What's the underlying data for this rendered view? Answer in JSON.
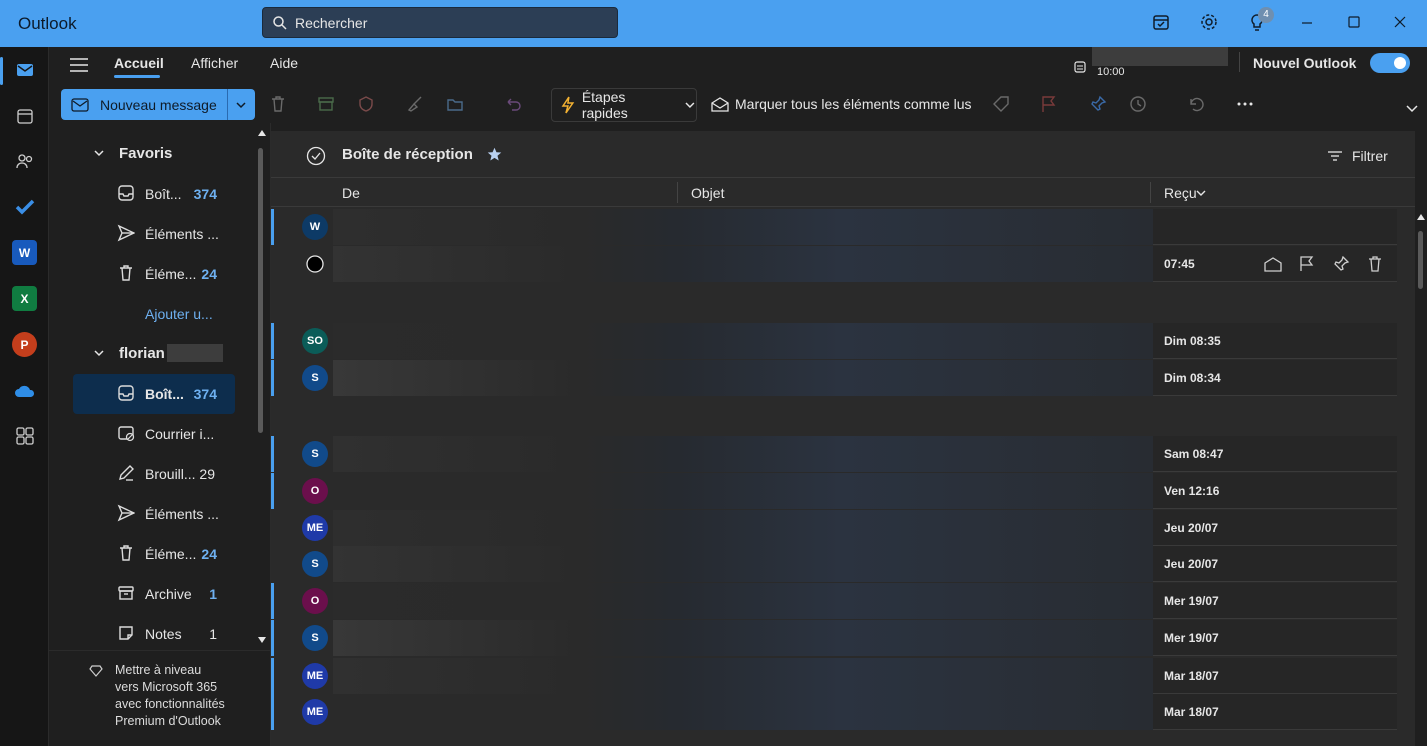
{
  "window": {
    "title": "Outlook"
  },
  "search": {
    "placeholder": "Rechercher"
  },
  "titlebar": {
    "badge_count": "4"
  },
  "menu": {
    "tabs": [
      "Accueil",
      "Afficher",
      "Aide"
    ],
    "clock": "10:00",
    "nouvel_outlook": "Nouvel Outlook"
  },
  "ribbon": {
    "new_message": "Nouveau message",
    "quick_steps": "Étapes rapides",
    "mark_all_read": "Marquer tous les éléments comme lus"
  },
  "folders": {
    "favorites_label": "Favoris",
    "fav": [
      {
        "label": "Boît...",
        "count": "374"
      },
      {
        "label": "Éléments ...",
        "count": ""
      },
      {
        "label": "Éléme...",
        "count": "24"
      }
    ],
    "add": "Ajouter u...",
    "account": "florian",
    "items": [
      {
        "label": "Boît...",
        "count": "374"
      },
      {
        "label": "Courrier i...",
        "count": ""
      },
      {
        "label": "Brouill...",
        "count": "29"
      },
      {
        "label": "Éléments ...",
        "count": ""
      },
      {
        "label": "Éléme...",
        "count": "24"
      },
      {
        "label": "Archive",
        "count": "1"
      },
      {
        "label": "Notes",
        "count": "1"
      }
    ],
    "upgrade": [
      "Mettre à niveau",
      "vers Microsoft 365",
      "avec fonctionnalités",
      "Premium d'Outlook"
    ]
  },
  "list": {
    "title": "Boîte de réception",
    "filter": "Filtrer",
    "col_from": "De",
    "col_subject": "Objet",
    "col_received": "Reçu"
  },
  "messages": [
    {
      "initials": "W",
      "color": "#0d3a66",
      "time": "",
      "unread": true
    },
    {
      "initials": "",
      "color": "",
      "time": "07:45",
      "unread": false
    },
    {
      "initials": "SO",
      "color": "#0b5c58",
      "time": "Dim 08:35",
      "unread": true
    },
    {
      "initials": "S",
      "color": "#114a8a",
      "time": "Dim 08:34",
      "unread": true
    },
    {
      "initials": "S",
      "color": "#114a8a",
      "time": "Sam 08:47",
      "unread": true
    },
    {
      "initials": "O",
      "color": "#6b0f4c",
      "time": "Ven 12:16",
      "unread": true
    },
    {
      "initials": "ME",
      "color": "#1f3aa8",
      "time": "Jeu 20/07",
      "unread": false
    },
    {
      "initials": "S",
      "color": "#114a8a",
      "time": "Jeu 20/07",
      "unread": false
    },
    {
      "initials": "O",
      "color": "#6b0f4c",
      "time": "Mer 19/07",
      "unread": true
    },
    {
      "initials": "S",
      "color": "#114a8a",
      "time": "Mer 19/07",
      "unread": true
    },
    {
      "initials": "ME",
      "color": "#1f3aa8",
      "time": "Mar 18/07",
      "unread": true
    },
    {
      "initials": "ME",
      "color": "#1f3aa8",
      "time": "Mar 18/07",
      "unread": true
    }
  ]
}
